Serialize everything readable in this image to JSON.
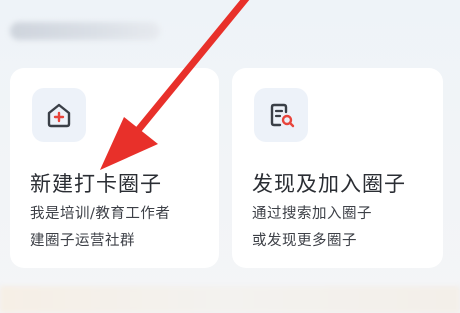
{
  "cards": [
    {
      "icon": "house-plus-icon",
      "title": "新建打卡圈子",
      "desc_line1": "我是培训/教育工作者",
      "desc_line2": "建圈子运营社群"
    },
    {
      "icon": "document-search-icon",
      "title": "发现及加入圈子",
      "desc_line1": "通过搜索加入圈子",
      "desc_line2": "或发现更多圈子"
    }
  ],
  "colors": {
    "accent": "#e8453c",
    "icon_stroke": "#3a3f47",
    "card_bg": "#ffffff",
    "tile_bg": "#edf2f9",
    "annotation_arrow": "#e8302a"
  }
}
